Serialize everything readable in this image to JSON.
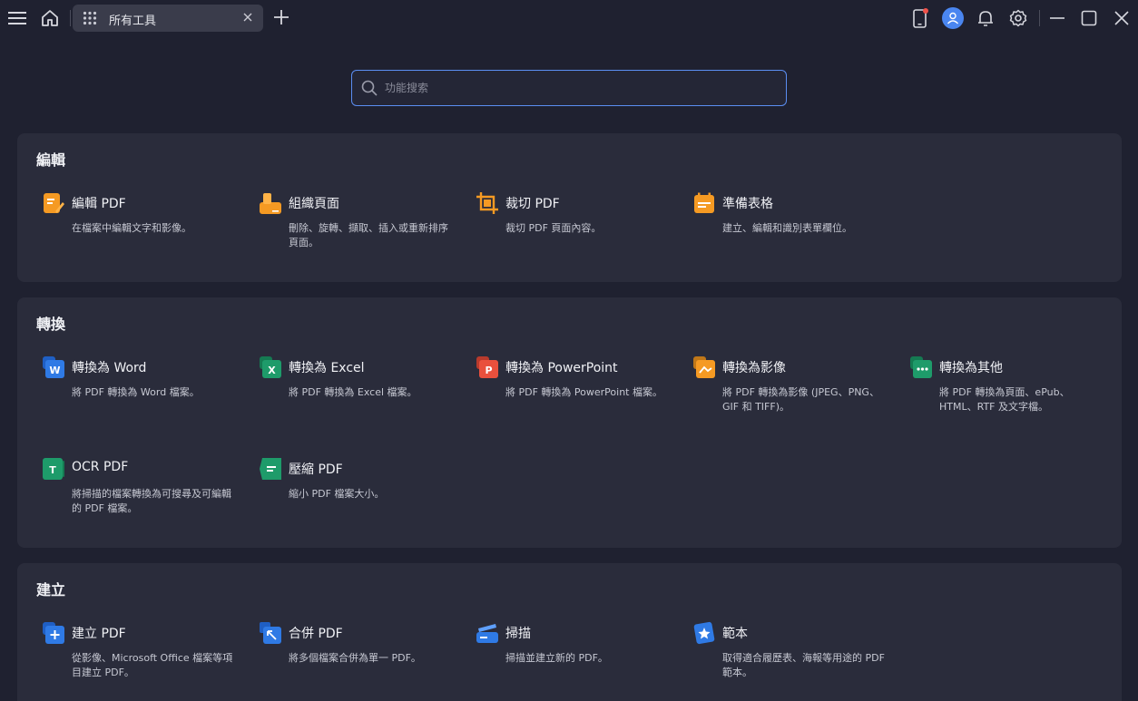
{
  "app": {
    "tab_title": "所有工具"
  },
  "search": {
    "placeholder": "功能搜索"
  },
  "sections": [
    {
      "title": "編輯",
      "tools": [
        {
          "name": "編輯 PDF",
          "desc": "在檔案中編輯文字和影像。",
          "icon": "edit-pdf-icon",
          "color": "#f59a23"
        },
        {
          "name": "組織頁面",
          "desc": "刪除、旋轉、擷取、插入或重新排序頁面。",
          "icon": "organize-pages-icon",
          "color": "#f59a23"
        },
        {
          "name": "裁切 PDF",
          "desc": "裁切 PDF 頁面內容。",
          "icon": "crop-pdf-icon",
          "color": "#f59a23"
        },
        {
          "name": "準備表格",
          "desc": "建立、編輯和識別表單欄位。",
          "icon": "prepare-form-icon",
          "color": "#f59a23"
        }
      ]
    },
    {
      "title": "轉換",
      "tools": [
        {
          "name": "轉換為 Word",
          "desc": "將 PDF 轉換為 Word 檔案。",
          "icon": "word-icon",
          "color": "#2f7ae5"
        },
        {
          "name": "轉換為 Excel",
          "desc": "將 PDF 轉換為 Excel 檔案。",
          "icon": "excel-icon",
          "color": "#1e9b6a"
        },
        {
          "name": "轉換為 PowerPoint",
          "desc": "將 PDF 轉換為 PowerPoint 檔案。",
          "icon": "powerpoint-icon",
          "color": "#e9503d"
        },
        {
          "name": "轉換為影像",
          "desc": "將 PDF 轉換為影像 (JPEG、PNG、GIF 和 TIFF)。",
          "icon": "image-icon",
          "color": "#f59a23"
        },
        {
          "name": "轉換為其他",
          "desc": "將 PDF 轉換為頁面、ePub、HTML、RTF 及文字檔。",
          "icon": "other-format-icon",
          "color": "#1e9b6a"
        },
        {
          "name": "OCR PDF",
          "desc": "將掃描的檔案轉換為可搜尋及可編輯的 PDF 檔案。",
          "icon": "ocr-icon",
          "color": "#1e9b6a"
        },
        {
          "name": "壓縮 PDF",
          "desc": "縮小 PDF 檔案大小。",
          "icon": "compress-icon",
          "color": "#1e9b6a"
        }
      ]
    },
    {
      "title": "建立",
      "tools": [
        {
          "name": "建立 PDF",
          "desc": "從影像、Microsoft Office 檔案等項目建立 PDF。",
          "icon": "create-pdf-icon",
          "color": "#2f7ae5"
        },
        {
          "name": "合併 PDF",
          "desc": "將多個檔案合併為單一 PDF。",
          "icon": "merge-pdf-icon",
          "color": "#2f7ae5"
        },
        {
          "name": "掃描",
          "desc": "掃描並建立新的 PDF。",
          "icon": "scan-icon",
          "color": "#2f7ae5"
        },
        {
          "name": "範本",
          "desc": "取得適合履歷表、海報等用途的 PDF 範本。",
          "icon": "template-icon",
          "color": "#2f7ae5"
        }
      ]
    }
  ]
}
